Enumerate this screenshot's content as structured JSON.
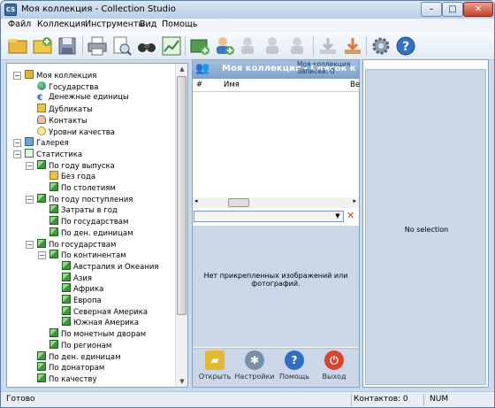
{
  "window": {
    "title": "Моя коллекция - Collection Studio",
    "app_icon": "CS"
  },
  "menu": [
    "Файл",
    "Коллекция",
    "Инструменты",
    "Вид",
    "Помощь"
  ],
  "toolbar": {
    "icons": [
      "open-collection-icon",
      "new-collection-icon",
      "save-icon",
      "print-icon",
      "print-preview-icon",
      "find-icon",
      "statistics-icon",
      "add-item-icon",
      "add-contact-icon",
      "edit-contact-icon",
      "remove-contact-icon",
      "delete-contact-icon",
      "import-icon",
      "export-icon",
      "settings-icon",
      "help-icon"
    ]
  },
  "tree": [
    {
      "label": "Моя коллекция",
      "level": 0,
      "icon": "collection-icon"
    },
    {
      "label": "Государства",
      "level": 1,
      "icon": "globe-icon"
    },
    {
      "label": "Денежные единицы",
      "level": 1,
      "icon": "currency-icon"
    },
    {
      "label": "Дубликаты",
      "level": 1,
      "icon": "duplicates-icon"
    },
    {
      "label": "Контакты",
      "level": 1,
      "icon": "contacts-icon"
    },
    {
      "label": "Уровни качества",
      "level": 1,
      "icon": "quality-icon"
    },
    {
      "label": "Галерея",
      "level": 0,
      "icon": "gallery-icon"
    },
    {
      "label": "Статистика",
      "level": 0,
      "icon": "statistics-icon"
    },
    {
      "label": "По году выпуска",
      "level": 1,
      "icon": "chart-icon"
    },
    {
      "label": "Без года",
      "level": 2,
      "icon": "folder-icon"
    },
    {
      "label": "По столетиям",
      "level": 2,
      "icon": "chart-icon"
    },
    {
      "label": "По году поступления",
      "level": 1,
      "icon": "chart-icon"
    },
    {
      "label": "Затраты в год",
      "level": 2,
      "icon": "chart-icon"
    },
    {
      "label": "По государствам",
      "level": 2,
      "icon": "chart-icon"
    },
    {
      "label": "По ден. единицам",
      "level": 2,
      "icon": "chart-icon"
    },
    {
      "label": "По государствам",
      "level": 1,
      "icon": "chart-icon"
    },
    {
      "label": "По континентам",
      "level": 2,
      "icon": "chart-icon"
    },
    {
      "label": "Австралия и Океания",
      "level": 3,
      "icon": "chart-icon"
    },
    {
      "label": "Азия",
      "level": 3,
      "icon": "chart-icon"
    },
    {
      "label": "Африка",
      "level": 3,
      "icon": "chart-icon"
    },
    {
      "label": "Европа",
      "level": 3,
      "icon": "chart-icon"
    },
    {
      "label": "Северная Америка",
      "level": 3,
      "icon": "chart-icon"
    },
    {
      "label": "Южная Америка",
      "level": 3,
      "icon": "chart-icon"
    },
    {
      "label": "По монетным дворам",
      "level": 2,
      "icon": "chart-icon"
    },
    {
      "label": "По регионам",
      "level": 2,
      "icon": "chart-icon"
    },
    {
      "label": "По ден. единицам",
      "level": 1,
      "icon": "chart-icon"
    },
    {
      "label": "По донаторам",
      "level": 1,
      "icon": "chart-icon"
    },
    {
      "label": "По качеству",
      "level": 1,
      "icon": "chart-icon"
    }
  ],
  "middle": {
    "header_title": "Моя коллекция - Список к",
    "header_sub1": "Моя коллекция",
    "header_sub2": "Записей: 0",
    "columns": [
      "#",
      "Имя",
      "Ве"
    ],
    "image_message": "Нет прикрепленных изображений или фотографий.",
    "actions": [
      {
        "label": "Открыть",
        "icon": "open-folder-icon",
        "color": "#e5b834"
      },
      {
        "label": "Настройки",
        "icon": "settings-gear-icon",
        "color": "#7b8ea8"
      },
      {
        "label": "Помощь",
        "icon": "help-icon",
        "color": "#2f6ec4"
      },
      {
        "label": "Выход",
        "icon": "exit-icon",
        "color": "#d9452b"
      }
    ]
  },
  "right": {
    "no_selection": "No selection"
  },
  "status": {
    "left": "Готово",
    "contacts": "Контактов: 0",
    "num": "NUM"
  }
}
